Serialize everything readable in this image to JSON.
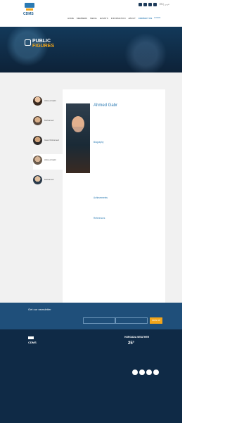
{
  "header": {
    "logo_text": "CDMS",
    "languages": "EN | عربي",
    "nav": [
      "HOME",
      "MEMBERS",
      "MEDIA",
      "EVENTS",
      "INFORMATION",
      "ABOUT",
      "CONTACT US"
    ],
    "login": "LOGIN"
  },
  "hero": {
    "title_line1": "PUBLIC",
    "title_line2": "FIGURES"
  },
  "sidebar": {
    "people": [
      "Ahmed Gabr",
      "Mohamed",
      "Gaar Mohamed",
      "Ahmed Gabr",
      "Mohamed"
    ]
  },
  "profile": {
    "name": "Ahmed Gabr",
    "section_biography": "Biography",
    "section_achievements": "Achievements",
    "section_references": "References"
  },
  "newsletter": {
    "title": "Get our newsletter",
    "signup": "SIGN UP"
  },
  "footer": {
    "weather_title": "HURGADA WEATHER",
    "temperature": "25°"
  }
}
